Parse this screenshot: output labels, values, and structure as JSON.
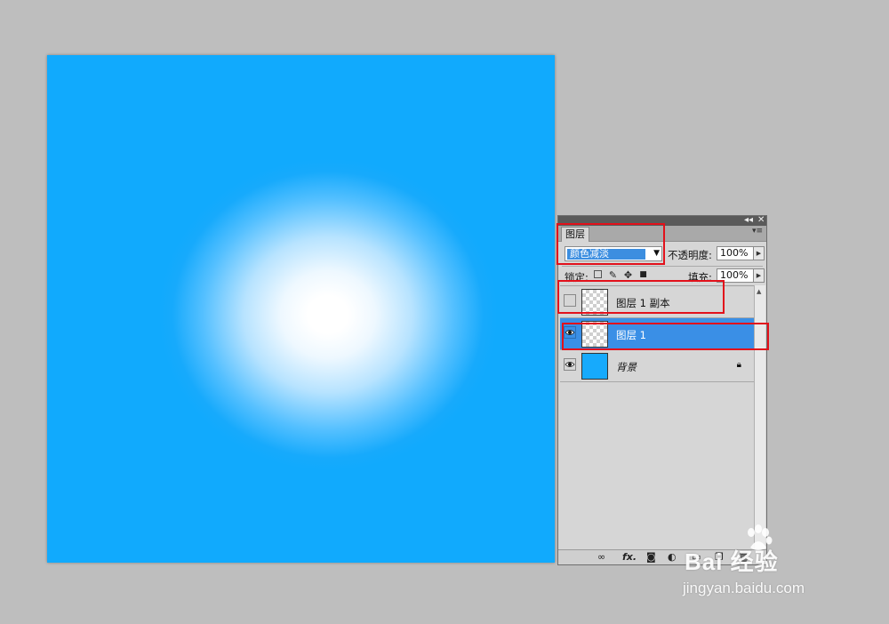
{
  "panel": {
    "tab_label": "图层",
    "blend_mode": "颜色减淡",
    "opacity_label": "不透明度:",
    "opacity_value": "100%",
    "lock_label": "锁定:",
    "fill_label": "填充:",
    "fill_value": "100%"
  },
  "layers": [
    {
      "name": "图层 1 副本",
      "visible": false,
      "selected": false,
      "thumbnail": "transparent"
    },
    {
      "name": "图层 1",
      "visible": true,
      "selected": true,
      "thumbnail": "transparent"
    },
    {
      "name": "背景",
      "visible": true,
      "selected": false,
      "thumbnail": "blue",
      "locked": true
    }
  ],
  "canvas": {
    "base_color": "#11aafd",
    "glow_color": "#ffffff"
  },
  "watermark": {
    "brand": "Bai  经验",
    "url": "jingyan.baidu.com"
  },
  "colors": {
    "selection": "#3a8fe6",
    "highlight_box": "#e2111b"
  }
}
